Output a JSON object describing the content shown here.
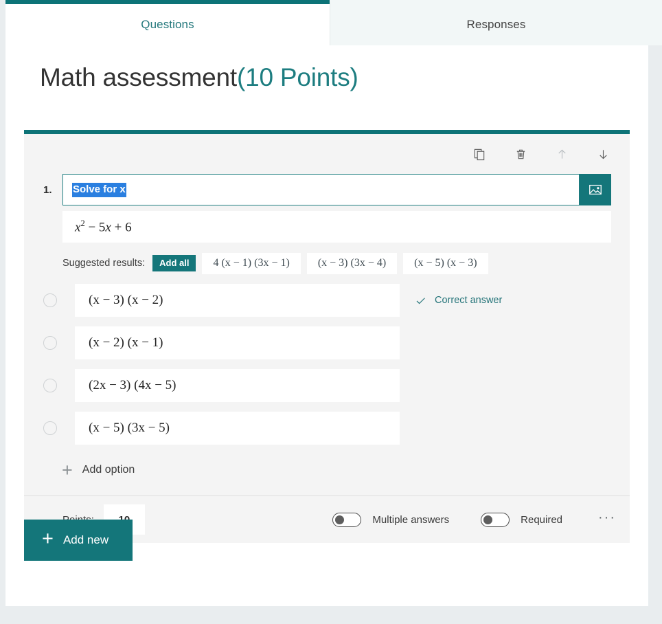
{
  "tabs": [
    {
      "label": "Questions",
      "active": true
    },
    {
      "label": "Responses",
      "active": false
    }
  ],
  "form": {
    "title": "Math assessment",
    "points_label": "(10 Points)"
  },
  "card_toolbar": {
    "copy": "copy-icon",
    "delete": "delete-icon",
    "move_up": "arrow-up-icon",
    "move_down": "arrow-down-icon"
  },
  "question": {
    "number": "1.",
    "text": "Solve for x",
    "image_button": "insert-image-icon",
    "math_expression": "x² − 5x + 6",
    "math_base": "x",
    "math_exponent": "2",
    "math_rest": " − 5x + 6"
  },
  "suggested": {
    "label": "Suggested results:",
    "add_all_label": "Add all",
    "chips": [
      "4 (x − 1) (3x − 1)",
      "(x − 3) (3x − 4)",
      "(x − 5) (x − 3)"
    ]
  },
  "options": [
    {
      "text": "(x − 3) (x − 2)",
      "correct_label": "Correct answer",
      "is_correct": true
    },
    {
      "text": "(x − 2) (x − 1)",
      "correct_label": "",
      "is_correct": false
    },
    {
      "text": "(2x − 3) (4x − 5)",
      "correct_label": "",
      "is_correct": false
    },
    {
      "text": "(x − 5) (3x − 5)",
      "correct_label": "",
      "is_correct": false
    }
  ],
  "add_option_label": "Add option",
  "footer": {
    "points_label": "Points:",
    "points_value": "10",
    "multiple_answers_label": "Multiple answers",
    "multiple_answers_on": false,
    "required_label": "Required",
    "required_on": false,
    "more_label": "···"
  },
  "add_new_label": "Add new",
  "colors": {
    "accent_teal": "#0d7377",
    "button_teal": "#14767a",
    "selection_blue": "#2a7fe0",
    "card_gray": "#f4f4f4",
    "page_bg": "#e9edef"
  }
}
